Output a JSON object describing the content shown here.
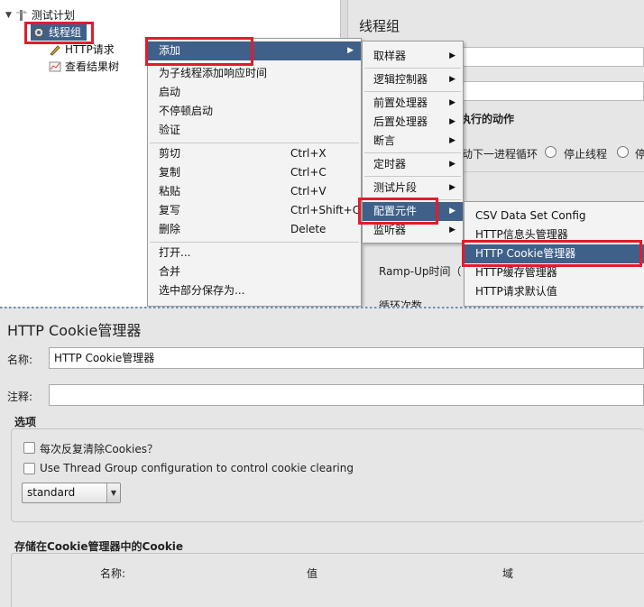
{
  "tree": {
    "root": "测试计划",
    "thread_group": "线程组",
    "http_request": "HTTP请求",
    "result_tree": "查看结果树"
  },
  "right_panel": {
    "title": "线程组",
    "section_actions": "执行的动作",
    "radio_next_loop": "动下一进程循环",
    "radio_stop_thread": "停止线程",
    "radio_stop_test": "停",
    "rampup": "Ramp-Up时间（",
    "loop_count": "循环次数"
  },
  "context_menu": {
    "items": [
      {
        "label": "添加"
      },
      {
        "label": "为子线程添加响应时间"
      },
      {
        "label": "启动"
      },
      {
        "label": "不停顿启动"
      },
      {
        "label": "验证"
      },
      {
        "label": "剪切",
        "accel": "Ctrl+X"
      },
      {
        "label": "复制",
        "accel": "Ctrl+C"
      },
      {
        "label": "粘贴",
        "accel": "Ctrl+V"
      },
      {
        "label": "复写",
        "accel": "Ctrl+Shift+C"
      },
      {
        "label": "删除",
        "accel": "Delete"
      },
      {
        "label": "打开..."
      },
      {
        "label": "合并"
      },
      {
        "label": "选中部分保存为..."
      }
    ]
  },
  "add_submenu": {
    "items": [
      {
        "label": "取样器"
      },
      {
        "label": "逻辑控制器"
      },
      {
        "label": "前置处理器"
      },
      {
        "label": "后置处理器"
      },
      {
        "label": "断言"
      },
      {
        "label": "定时器"
      },
      {
        "label": "测试片段"
      },
      {
        "label": "配置元件"
      },
      {
        "label": "监听器"
      }
    ]
  },
  "config_submenu": {
    "items": [
      {
        "label": "CSV Data Set Config"
      },
      {
        "label": "HTTP信息头管理器"
      },
      {
        "label": "HTTP Cookie管理器"
      },
      {
        "label": "HTTP缓存管理器"
      },
      {
        "label": "HTTP请求默认值"
      }
    ]
  },
  "cookie_manager": {
    "title": "HTTP Cookie管理器",
    "name_label": "名称:",
    "name_value": "HTTP Cookie管理器",
    "comment_label": "注释:",
    "comment_value": "",
    "options_label": "选项",
    "clear_each_iteration": "每次反复清除Cookies？",
    "use_thread_group": "Use Thread Group configuration to control cookie clearing",
    "policy_value": "standard",
    "stored_cookies_label": "存储在Cookie管理器中的Cookie",
    "columns": [
      "名称:",
      "值",
      "域"
    ]
  },
  "colors": {
    "selection": "#3e6089",
    "highlight_box": "#e41b2a",
    "panel_bg": "#e6e6e6"
  }
}
